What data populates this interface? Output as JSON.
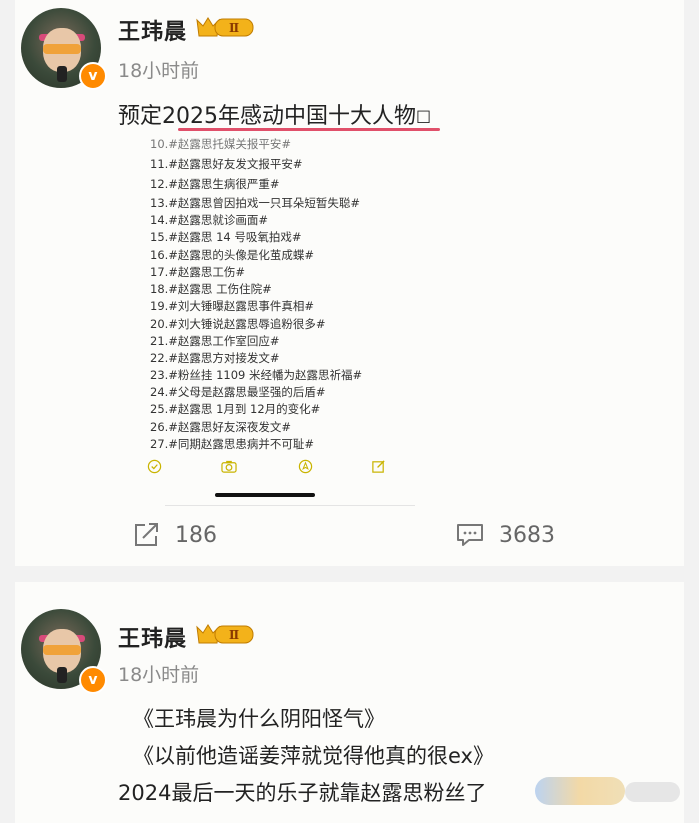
{
  "post1": {
    "author": "王玮晨",
    "badge": "Ⅱ",
    "time": "18小时前",
    "text": "预定2025年感动中国十大人物",
    "text_tail_glyph": "□",
    "screenshot_lines": [
      "10.#赵露思托媒关报平安#",
      "11.#赵露思好友发文报平安#",
      "12.#赵露思生病很严重#",
      "13.#赵露思曾因拍戏一只耳朵短暂失聪#",
      "14.#赵露思就诊画面#",
      "15.#赵露思 14 号吸氧拍戏#",
      "16.#赵露思的头像是化茧成蝶#",
      "17.#赵露思工伤#",
      "18.#赵露思 工伤住院#",
      "19.#刘大锤曝赵露思事件真相#",
      "20.#刘大锤说赵露思辱追粉很多#",
      "21.#赵露思工作室回应#",
      "22.#赵露思方对接发文#",
      "23.#粉丝挂 1109 米经幡为赵露思祈福#",
      "24.#父母是赵露思最坚强的后盾#",
      "25.#赵露思 1月到 12月的变化#",
      "26.#赵露思好友深夜发文#",
      "27.#同期赵露思患病并不可耻#"
    ],
    "toolbar_icons": [
      "check-circle-icon",
      "camera-icon",
      "location-icon",
      "edit-icon"
    ],
    "share_count": "186",
    "comment_count": "3683"
  },
  "post2": {
    "author": "王玮晨",
    "badge": "Ⅱ",
    "time": "18小时前",
    "lines": [
      "《王玮晨为什么阴阳怪气》",
      "《以前他造谣姜萍就觉得他真的很ex》",
      "2024最后一天的乐子就靠赵露思粉丝了"
    ]
  },
  "colors": {
    "accent_underline": "#e0506a",
    "verified_badge": "#ff8a00",
    "crown_gold": "#f3b21a"
  }
}
